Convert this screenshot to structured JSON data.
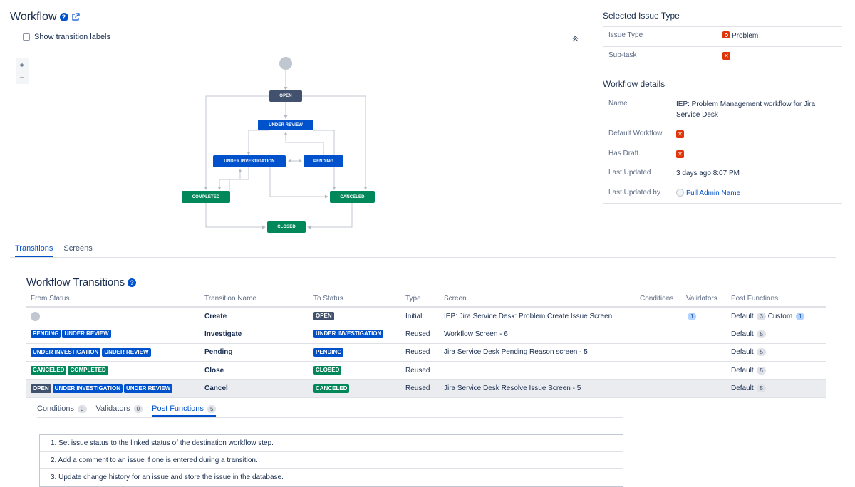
{
  "header": {
    "title": "Workflow",
    "show_labels": "Show transition labels"
  },
  "zoom": {
    "plus": "+",
    "minus": "−"
  },
  "diagram": {
    "nodes": [
      {
        "id": "open",
        "label": "OPEN"
      },
      {
        "id": "under-review",
        "label": "UNDER REVIEW"
      },
      {
        "id": "under-investigation",
        "label": "UNDER INVESTIGATION"
      },
      {
        "id": "pending",
        "label": "PENDING"
      },
      {
        "id": "completed",
        "label": "COMPLETED"
      },
      {
        "id": "canceled",
        "label": "CANCELED"
      },
      {
        "id": "closed",
        "label": "CLOSED"
      }
    ]
  },
  "issue_type_panel": {
    "heading": "Selected Issue Type",
    "rows": [
      {
        "key": "Issue Type",
        "value": "Problem"
      },
      {
        "key": "Sub-task",
        "value": ""
      }
    ]
  },
  "workflow_details": {
    "heading": "Workflow details",
    "name_key": "Name",
    "name_value": "IEP: Problem Management workflow for Jira Service Desk",
    "default_key": "Default Workflow",
    "draft_key": "Has Draft",
    "updated_key": "Last Updated",
    "updated_value": "3 days ago 8:07 PM",
    "updated_by_key": "Last Updated by",
    "updated_by_value": "Full Admin Name"
  },
  "tabs": [
    "Transitions",
    "Screens"
  ],
  "transitions": {
    "heading": "Workflow Transitions",
    "columns": [
      "From Status",
      "Transition Name",
      "To Status",
      "Type",
      "Screen",
      "Conditions",
      "Validators",
      "Post Functions"
    ],
    "rows": [
      {
        "from": [],
        "name": "Create",
        "to": "OPEN",
        "to_color": "dark",
        "type": "Initial",
        "screen": "IEP: Jira Service Desk: Problem Create Issue Screen",
        "validators": "1",
        "pf_default": "Default",
        "pf_default_count": "3",
        "pf_custom": "Custom",
        "pf_custom_count": "1"
      },
      {
        "from": [
          {
            "label": "PENDING",
            "color": "blue"
          },
          {
            "label": "UNDER REVIEW",
            "color": "blue"
          }
        ],
        "name": "Investigate",
        "to": "UNDER INVESTIGATION",
        "to_color": "blue",
        "type": "Reused",
        "screen": "Workflow Screen - 6",
        "validators": "",
        "pf_default": "Default",
        "pf_default_count": "5"
      },
      {
        "from": [
          {
            "label": "UNDER INVESTIGATION",
            "color": "blue"
          },
          {
            "label": "UNDER REVIEW",
            "color": "blue"
          }
        ],
        "name": "Pending",
        "to": "PENDING",
        "to_color": "blue",
        "type": "Reused",
        "screen": "Jira Service Desk Pending Reason screen - 5",
        "validators": "",
        "pf_default": "Default",
        "pf_default_count": "5"
      },
      {
        "from": [
          {
            "label": "CANCELED",
            "color": "green"
          },
          {
            "label": "COMPLETED",
            "color": "green"
          }
        ],
        "name": "Close",
        "to": "CLOSED",
        "to_color": "green",
        "type": "Reused",
        "screen": "",
        "validators": "",
        "pf_default": "Default",
        "pf_default_count": "5"
      },
      {
        "from": [
          {
            "label": "OPEN",
            "color": "dark"
          },
          {
            "label": "UNDER INVESTIGATION",
            "color": "blue"
          },
          {
            "label": "UNDER REVIEW",
            "color": "blue"
          }
        ],
        "name": "Cancel",
        "to": "CANCELED",
        "to_color": "green",
        "type": "Reused",
        "screen": "Jira Service Desk Resolve Issue Screen - 5",
        "validators": "",
        "pf_default": "Default",
        "pf_default_count": "5"
      }
    ]
  },
  "subtabs": [
    {
      "label": "Conditions",
      "count": "0"
    },
    {
      "label": "Validators",
      "count": "0"
    },
    {
      "label": "Post Functions",
      "count": "5"
    }
  ],
  "post_functions": [
    "1.  Set issue status to the linked status of the destination workflow step.",
    "2.  Add a comment to an issue if one is entered during a transition.",
    "3.  Update change history for an issue and store the issue in the database."
  ],
  "colors": {
    "blue": "#0052cc",
    "green": "#00875a",
    "dark": "#42526e",
    "error": "#de350b"
  }
}
